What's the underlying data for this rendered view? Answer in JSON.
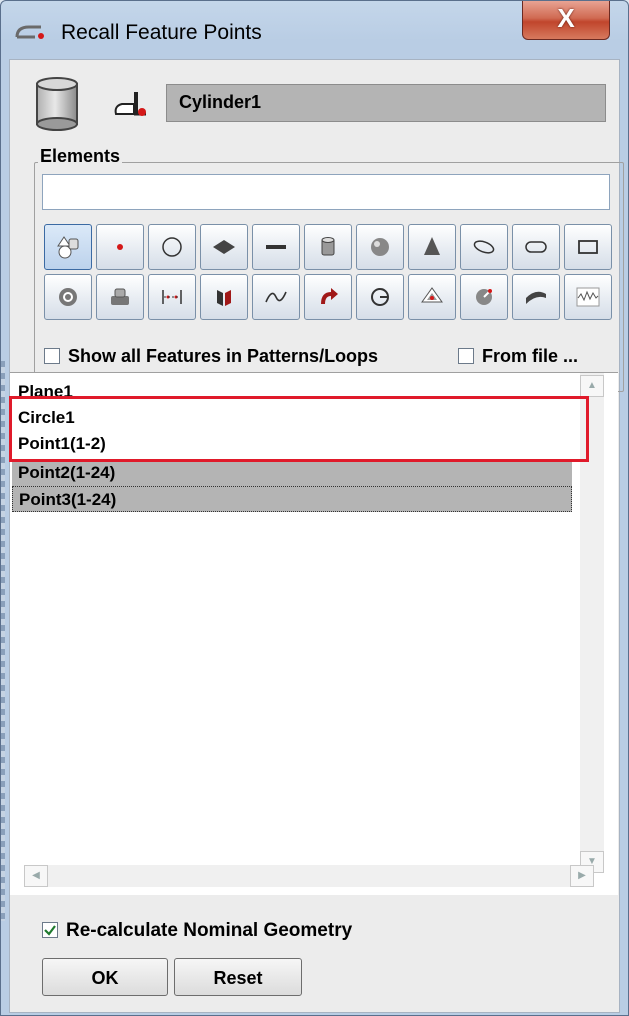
{
  "window": {
    "title": "Recall Feature Points",
    "close_label": "X"
  },
  "header": {
    "feature_name": "Cylinder1"
  },
  "elements": {
    "group_label": "Elements",
    "filter_value": "",
    "toolbar_row1": [
      "all-types-icon",
      "point-icon",
      "circle-icon",
      "plane-icon",
      "line-icon",
      "cylinder-icon",
      "sphere-icon",
      "cone-icon",
      "ellipse-icon",
      "slot-icon",
      "rectangle-icon"
    ],
    "toolbar_row2": [
      "ring-icon",
      "step-cylinder-icon",
      "distance-icon",
      "symmetry-plane-icon",
      "curve-icon",
      "turn-icon",
      "circle-point-icon",
      "surface-point-icon",
      "angle-icon",
      "freeform-surface-icon",
      "profile-icon"
    ]
  },
  "options": {
    "show_all_label": "Show all Features in Patterns/Loops",
    "from_file_label": "From file ...",
    "show_all_checked": false,
    "from_file_checked": false
  },
  "feature_list": [
    {
      "label": "Plane1",
      "selected": false
    },
    {
      "label": "Circle1",
      "selected": false
    },
    {
      "label": "Point1(1-2)",
      "selected": false
    },
    {
      "label": "Point2(1-24)",
      "selected": true
    },
    {
      "label": "Point3(1-24)",
      "selected": true
    }
  ],
  "footer": {
    "recalc_label": "Re-calculate Nominal Geometry",
    "recalc_checked": true,
    "ok_label": "OK",
    "reset_label": "Reset"
  },
  "colors": {
    "highlight": "#e01a2a",
    "selection": "#b4b4b4"
  }
}
